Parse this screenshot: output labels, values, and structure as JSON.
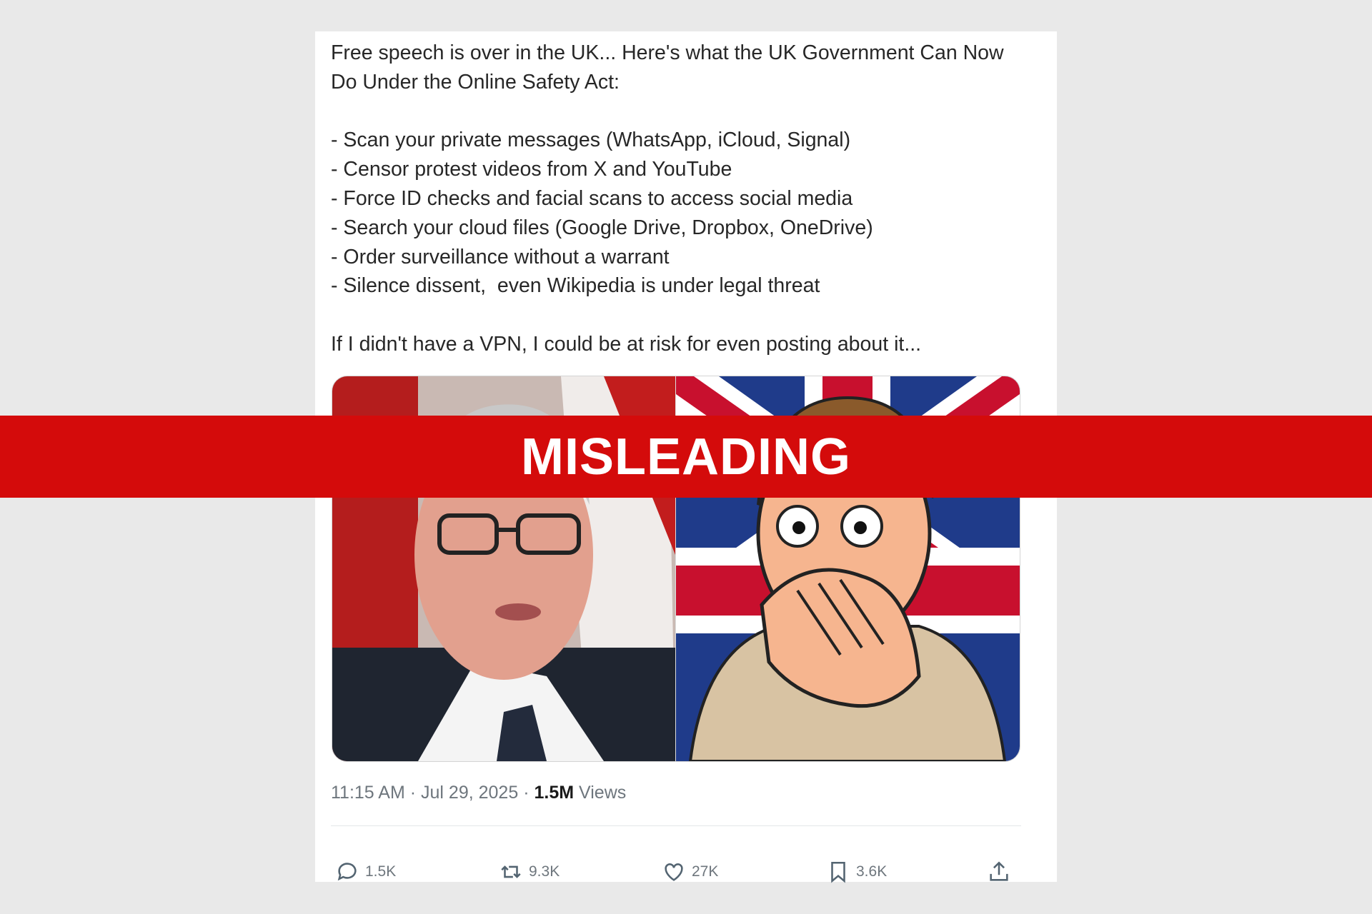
{
  "post": {
    "text": "Free speech is over in the UK... Here's what the UK Government Can Now Do Under the Online Safety Act:\n\n- Scan your private messages (WhatsApp, iCloud, Signal)\n- Censor protest videos from X and YouTube\n- Force ID checks and facial scans to access social media\n- Search your cloud files (Google Drive, Dropbox, OneDrive)\n- Order surveillance without a warrant\n- Silence dissent,  even Wikipedia is under legal threat\n\nIf I didn't have a VPN, I could be at risk for even posting about it...",
    "time": "11:15 AM",
    "separator": "·",
    "date": "Jul 29, 2025",
    "views_count": "1.5M",
    "views_label": "Views"
  },
  "actions": {
    "replies": "1.5K",
    "reposts": "9.3K",
    "likes": "27K",
    "bookmarks": "3.6K"
  },
  "icons": {
    "reply": "speech-bubble-icon",
    "repost": "repost-arrows-icon",
    "like": "heart-icon",
    "bookmark": "bookmark-icon",
    "share": "share-upload-icon"
  },
  "banner": {
    "label": "MISLEADING",
    "color": "#d40b0b"
  }
}
